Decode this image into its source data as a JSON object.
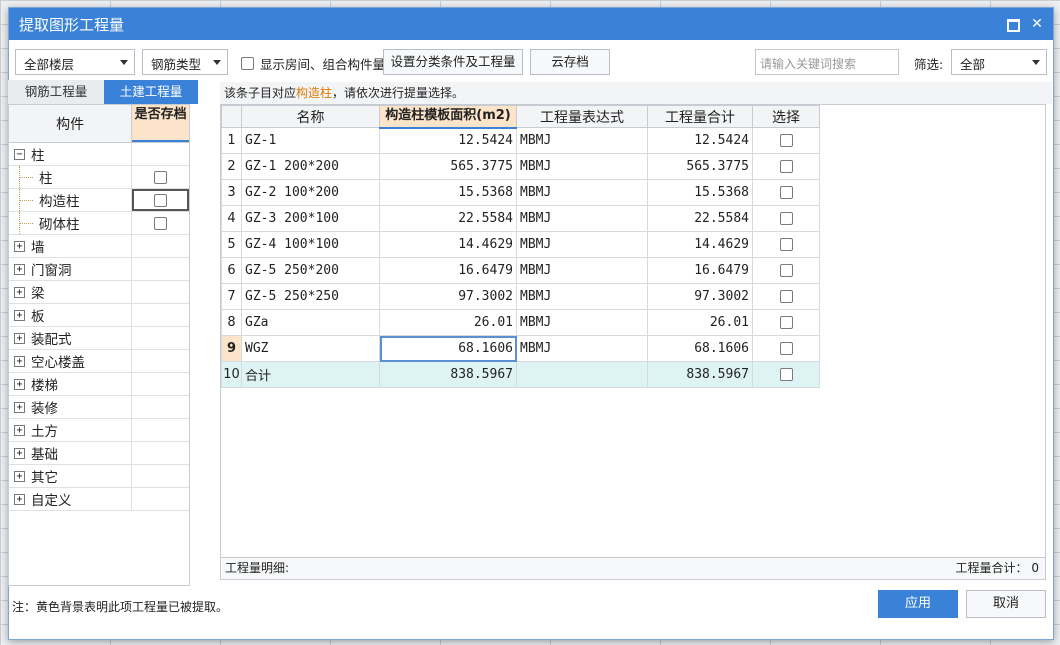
{
  "dialog": {
    "title": "提取图形工程量",
    "note": "注：黄色背景表明此项工程量已被提取。",
    "ok_label": "应用",
    "cancel_label": "取消"
  },
  "toolbar": {
    "floor_select": "全部楼层",
    "rebar_type_select": "钢筋类型",
    "show_rooms_label": "显示房间、组合构件量",
    "set_conditions_button": "设置分类条件及工程量",
    "cloud_archive_button": "云存档",
    "search_placeholder": "请输入关键词搜索",
    "filter_label": "筛选:",
    "filter_select": "全部"
  },
  "tabs": {
    "rebar": "钢筋工程量",
    "civil": "土建工程量"
  },
  "tree": {
    "col_component": "构件",
    "col_archived": "是否存档",
    "items": [
      {
        "label": "柱",
        "expander": "−",
        "child": false,
        "checkbox": false
      },
      {
        "label": "柱",
        "expander": "",
        "child": true,
        "checkbox": true
      },
      {
        "label": "构造柱",
        "expander": "",
        "child": true,
        "checkbox": true
      },
      {
        "label": "砌体柱",
        "expander": "",
        "child": true,
        "checkbox": true
      },
      {
        "label": "墙",
        "expander": "+",
        "child": false,
        "checkbox": false
      },
      {
        "label": "门窗洞",
        "expander": "+",
        "child": false,
        "checkbox": false
      },
      {
        "label": "梁",
        "expander": "+",
        "child": false,
        "checkbox": false
      },
      {
        "label": "板",
        "expander": "+",
        "child": false,
        "checkbox": false
      },
      {
        "label": "装配式",
        "expander": "+",
        "child": false,
        "checkbox": false
      },
      {
        "label": "空心楼盖",
        "expander": "+",
        "child": false,
        "checkbox": false
      },
      {
        "label": "楼梯",
        "expander": "+",
        "child": false,
        "checkbox": false
      },
      {
        "label": "装修",
        "expander": "+",
        "child": false,
        "checkbox": false
      },
      {
        "label": "土方",
        "expander": "+",
        "child": false,
        "checkbox": false
      },
      {
        "label": "基础",
        "expander": "+",
        "child": false,
        "checkbox": false
      },
      {
        "label": "其它",
        "expander": "+",
        "child": false,
        "checkbox": false
      },
      {
        "label": "自定义",
        "expander": "+",
        "child": false,
        "checkbox": false
      }
    ]
  },
  "hint": {
    "prefix": "该条子目对应",
    "highlight": "构造柱",
    "suffix": "，请依次进行提量选择。"
  },
  "table": {
    "headers": [
      "名称",
      "构造柱模板面积(m2)",
      "工程量表达式",
      "工程量合计",
      "选择"
    ],
    "rows": [
      {
        "n": "1",
        "name": "GZ-1",
        "area": "12.5424",
        "expr": "MBMJ",
        "total": "12.5424"
      },
      {
        "n": "2",
        "name": "GZ-1 200*200",
        "area": "565.3775",
        "expr": "MBMJ",
        "total": "565.3775"
      },
      {
        "n": "3",
        "name": "GZ-2 100*200",
        "area": "15.5368",
        "expr": "MBMJ",
        "total": "15.5368"
      },
      {
        "n": "4",
        "name": "GZ-3 200*100",
        "area": "22.5584",
        "expr": "MBMJ",
        "total": "22.5584"
      },
      {
        "n": "5",
        "name": "GZ-4 100*100",
        "area": "14.4629",
        "expr": "MBMJ",
        "total": "14.4629"
      },
      {
        "n": "6",
        "name": "GZ-5 250*200",
        "area": "16.6479",
        "expr": "MBMJ",
        "total": "16.6479"
      },
      {
        "n": "7",
        "name": "GZ-5 250*250",
        "area": "97.3002",
        "expr": "MBMJ",
        "total": "97.3002"
      },
      {
        "n": "8",
        "name": "GZa",
        "area": "26.01",
        "expr": "MBMJ",
        "total": "26.01"
      },
      {
        "n": "9",
        "name": "WGZ",
        "area": "68.1606",
        "expr": "MBMJ",
        "total": "68.1606"
      },
      {
        "n": "10",
        "name": "合计",
        "area": "838.5967",
        "expr": "",
        "total": "838.5967"
      }
    ]
  },
  "detail": {
    "label": "工程量明细:",
    "total_label": "工程量合计：",
    "total_value": "0"
  }
}
